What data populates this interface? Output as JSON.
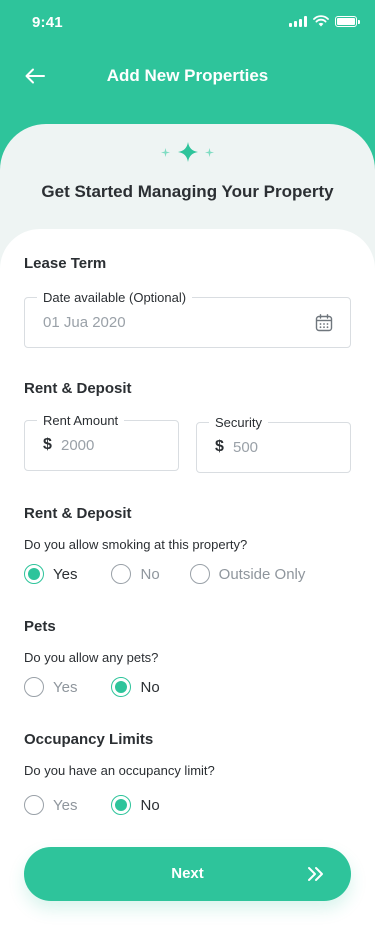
{
  "status_bar": {
    "time": "9:41"
  },
  "header": {
    "title": "Add New Properties"
  },
  "hero": {
    "title": "Get Started Managing Your Property"
  },
  "lease_term": {
    "title": "Lease Term",
    "date_field": {
      "label": "Date available (Optional)",
      "value": "01 Jua 2020"
    }
  },
  "rent_deposit": {
    "title": "Rent & Deposit",
    "rent_field": {
      "label": "Rent Amount",
      "currency": "$",
      "value": "2000"
    },
    "security_field": {
      "label": "Security",
      "currency": "$",
      "value": "500"
    }
  },
  "smoking": {
    "title": "Rent & Deposit",
    "question": "Do you allow smoking at this property?",
    "options": [
      {
        "label": "Yes",
        "checked": true
      },
      {
        "label": "No",
        "checked": false
      },
      {
        "label": "Outside Only",
        "checked": false
      }
    ]
  },
  "pets": {
    "title": "Pets",
    "question": "Do you allow any pets?",
    "options": [
      {
        "label": "Yes",
        "checked": false
      },
      {
        "label": "No",
        "checked": true
      }
    ]
  },
  "occupancy": {
    "title": "Occupancy Limits",
    "question": "Do you have an occupancy limit?",
    "options": [
      {
        "label": "Yes",
        "checked": false
      },
      {
        "label": "No",
        "checked": true
      }
    ]
  },
  "next_button": {
    "label": "Next"
  },
  "colors": {
    "accent": "#2ec49b",
    "text": "#2b2f33",
    "muted": "#9aa1a8",
    "hero_bg": "#eef4f3"
  }
}
